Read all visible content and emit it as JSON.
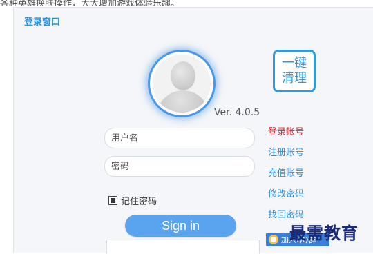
{
  "page": {
    "top_caption": "各种英雄换肤操作，大大增加游戏体验乐趣。"
  },
  "window": {
    "title": "登录窗口",
    "version": "Ver. 4.0.5",
    "clean_button": "一键清理"
  },
  "form": {
    "username_placeholder": "用户名",
    "password_placeholder": "密码",
    "remember_label": "记住密码",
    "remember_checked": true,
    "signin_label": "Sign in"
  },
  "side_links": [
    {
      "label": "登录帐号",
      "active": true
    },
    {
      "label": "注册账号",
      "active": false
    },
    {
      "label": "充值账号",
      "active": false
    },
    {
      "label": "修改密码",
      "active": false
    },
    {
      "label": "找回密码",
      "active": false
    }
  ],
  "qq_badge": {
    "label": "加入QQ群",
    "icon": "qq-icon"
  },
  "watermark": "最需教育",
  "colors": {
    "accent": "#2b99e6",
    "active_link": "#e0232a",
    "signin": "#5aa3ef"
  }
}
